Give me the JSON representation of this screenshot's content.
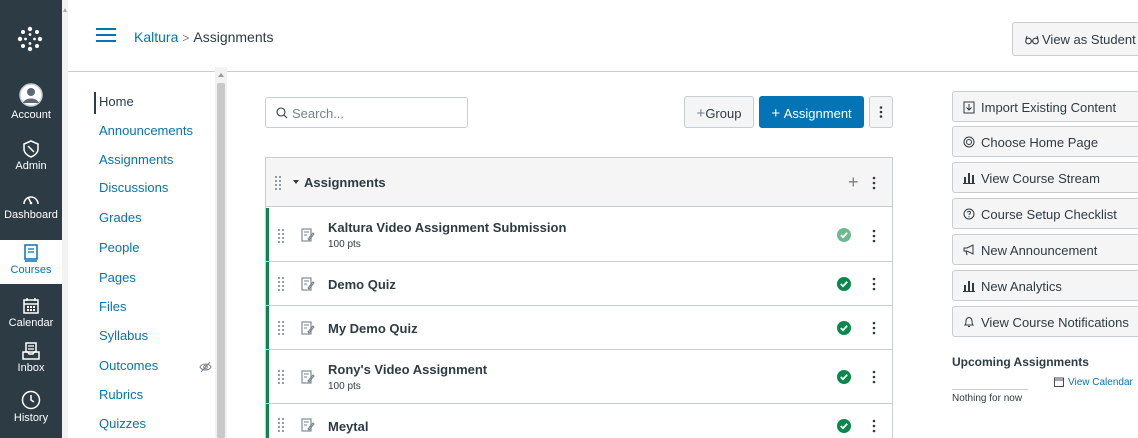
{
  "global_nav": {
    "items": [
      {
        "label": "Account",
        "icon": "avatar-icon"
      },
      {
        "label": "Admin",
        "icon": "shield-icon"
      },
      {
        "label": "Dashboard",
        "icon": "dashboard-icon"
      },
      {
        "label": "Courses",
        "icon": "book-icon"
      },
      {
        "label": "Calendar",
        "icon": "calendar-icon"
      },
      {
        "label": "Inbox",
        "icon": "inbox-icon"
      },
      {
        "label": "History",
        "icon": "clock-icon"
      }
    ],
    "colors": {
      "background": "#2d3b45",
      "active_text": "#0374b5"
    }
  },
  "header": {
    "breadcrumb": {
      "course": "Kaltura",
      "separator": ">",
      "page": "Assignments"
    },
    "view_as_student": "View as Student"
  },
  "course_nav": {
    "items": [
      "Home",
      "Announcements",
      "Assignments",
      "Discussions",
      "Grades",
      "People",
      "Pages",
      "Files",
      "Syllabus",
      "Outcomes",
      "Rubrics",
      "Quizzes"
    ]
  },
  "toolbar": {
    "search_placeholder": "Search...",
    "group_button": "Group",
    "assignment_button": "Assignment"
  },
  "assignments": {
    "group_title": "Assignments",
    "rows": [
      {
        "title": "Kaltura Video Assignment Submission",
        "points": "100 pts",
        "published": true
      },
      {
        "title": "Demo Quiz",
        "points": "",
        "published": true
      },
      {
        "title": "My Demo Quiz",
        "points": "",
        "published": true
      },
      {
        "title": "Rony's Video Assignment",
        "points": "100 pts",
        "published": true
      },
      {
        "title": "Meytal",
        "points": "",
        "published": true
      }
    ]
  },
  "sidebar": {
    "buttons": [
      {
        "label": "Import Existing Content",
        "icon": "import-icon"
      },
      {
        "label": "Choose Home Page",
        "icon": "target-icon"
      },
      {
        "label": "View Course Stream",
        "icon": "analytics-icon"
      },
      {
        "label": "Course Setup Checklist",
        "icon": "question-icon"
      },
      {
        "label": "New Announcement",
        "icon": "megaphone-icon"
      },
      {
        "label": "New Analytics",
        "icon": "analytics-icon"
      },
      {
        "label": "View Course Notifications",
        "icon": "bell-icon"
      }
    ],
    "upcoming_title": "Upcoming Assignments",
    "view_calendar": "View Calendar",
    "nothing": "Nothing for now"
  },
  "colors": {
    "brand_blue": "#0374b5",
    "success_green": "#0b874b",
    "text": "#2d3b45"
  }
}
